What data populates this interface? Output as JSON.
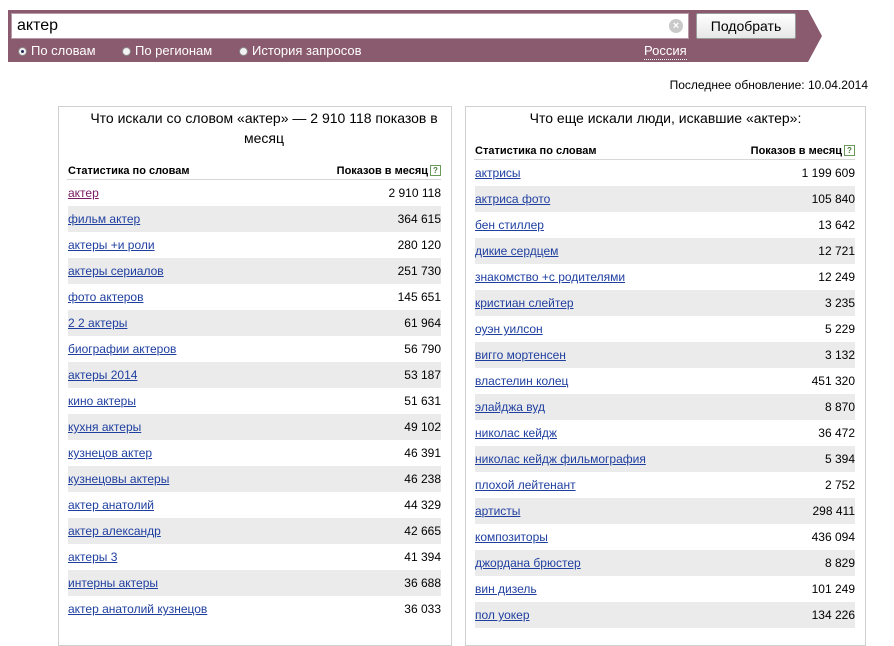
{
  "search": {
    "value": "актер",
    "clear": "×",
    "button": "Подобрать"
  },
  "modes": [
    {
      "label": "По словам",
      "selected": true
    },
    {
      "label": "По регионам",
      "selected": false
    },
    {
      "label": "История запросов",
      "selected": false
    }
  ],
  "region": "Россия",
  "last_update": "Последнее обновление: 10.04.2014",
  "left": {
    "title": "Что искали со словом «актер» — 2 910 118 показов в месяц",
    "col_query": "Статистика по словам",
    "col_count": "Показов в месяц",
    "help": "?",
    "rows": [
      {
        "q": "актер",
        "n": "2 910 118"
      },
      {
        "q": "фильм актер",
        "n": "364 615"
      },
      {
        "q": "актеры +и роли",
        "n": "280 120"
      },
      {
        "q": "актеры сериалов",
        "n": "251 730"
      },
      {
        "q": "фото актеров",
        "n": "145 651"
      },
      {
        "q": "2 2 актеры",
        "n": "61 964"
      },
      {
        "q": "биографии актеров",
        "n": "56 790"
      },
      {
        "q": "актеры 2014",
        "n": "53 187"
      },
      {
        "q": "кино актеры",
        "n": "51 631"
      },
      {
        "q": "кухня актеры",
        "n": "49 102"
      },
      {
        "q": "кузнецов актер",
        "n": "46 391"
      },
      {
        "q": "кузнецовы актеры",
        "n": "46 238"
      },
      {
        "q": "актер анатолий",
        "n": "44 329"
      },
      {
        "q": "актер александр",
        "n": "42 665"
      },
      {
        "q": "актеры 3",
        "n": "41 394"
      },
      {
        "q": "интерны актеры",
        "n": "36 688"
      },
      {
        "q": "актер анатолий кузнецов",
        "n": "36 033"
      }
    ]
  },
  "right": {
    "title": "Что еще искали люди, искавшие «актер»:",
    "col_query": "Статистика по словам",
    "col_count": "Показов в месяц",
    "help": "?",
    "rows": [
      {
        "q": "актрисы",
        "n": "1 199 609"
      },
      {
        "q": "актриса фото",
        "n": "105 840"
      },
      {
        "q": "бен стиллер",
        "n": "13 642"
      },
      {
        "q": "дикие сердцем",
        "n": "12 721"
      },
      {
        "q": "знакомство +с родителями",
        "n": "12 249"
      },
      {
        "q": "кристиан слейтер",
        "n": "3 235"
      },
      {
        "q": "оуэн уилсон",
        "n": "5 229"
      },
      {
        "q": "вигго мортенсен",
        "n": "3 132"
      },
      {
        "q": "властелин колец",
        "n": "451 320"
      },
      {
        "q": "элайджа вуд",
        "n": "8 870"
      },
      {
        "q": "николас кейдж",
        "n": "36 472"
      },
      {
        "q": "николас кейдж фильмография",
        "n": "5 394"
      },
      {
        "q": "плохой лейтенант",
        "n": "2 752"
      },
      {
        "q": "артисты",
        "n": "298 411"
      },
      {
        "q": "композиторы",
        "n": "436 094"
      },
      {
        "q": "джордана брюстер",
        "n": "8 829"
      },
      {
        "q": "вин дизель",
        "n": "101 249"
      },
      {
        "q": "пол уокер",
        "n": "134 226"
      }
    ]
  }
}
